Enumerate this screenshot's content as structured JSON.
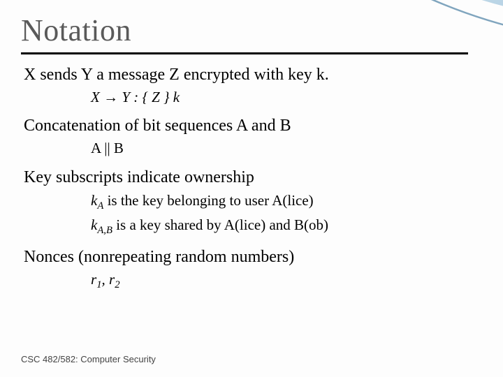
{
  "title": "Notation",
  "items": [
    {
      "main": "X sends Y a message Z encrypted with key k.",
      "sub_html": "X → Y : { Z } k",
      "sub_style": "italic"
    },
    {
      "main": "Concatenation of bit sequences A and B",
      "sub_html": "A || B",
      "sub_style": "plain"
    },
    {
      "main": "Key subscripts indicate ownership",
      "sub_lines": [
        "<span class='ital'>k<sub>A</sub></span> is the key belonging to user A(lice)",
        "<span class='ital'>k<sub>A,B</sub></span> is a key shared by A(lice) and B(ob)"
      ]
    },
    {
      "main": "Nonces (nonrepeating random numbers)",
      "sub_html": "r<sub>1</sub>, r<sub>2</sub>",
      "sub_style": "italic"
    }
  ],
  "footer": "CSC 482/582: Computer Security",
  "colors": {
    "swoosh_light": "#cfe6f2",
    "swoosh_mid": "#8fb9d6",
    "swoosh_line": "#2a5d82"
  }
}
